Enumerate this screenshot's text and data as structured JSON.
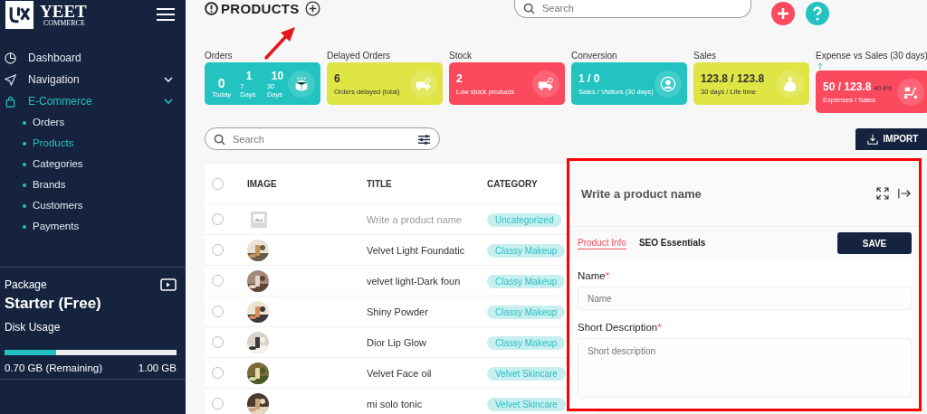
{
  "sidebar": {
    "logo": {
      "word": "YEET",
      "sub": "COMMERCE"
    },
    "items": [
      {
        "label": "Dashboard",
        "active": false,
        "expandable": false
      },
      {
        "label": "Navigation",
        "active": false,
        "expandable": true
      },
      {
        "label": "E-Commerce",
        "active": true,
        "expandable": true,
        "children": [
          {
            "label": "Orders",
            "selected": false
          },
          {
            "label": "Products",
            "selected": true
          },
          {
            "label": "Categories",
            "selected": false
          },
          {
            "label": "Brands",
            "selected": false
          },
          {
            "label": "Customers",
            "selected": false
          },
          {
            "label": "Payments",
            "selected": false
          }
        ]
      }
    ],
    "package": {
      "label": "Package",
      "plan": "Starter (Free)"
    },
    "disk": {
      "label": "Disk Usage",
      "level": 0.3,
      "remaining": "0.70 GB (Remaining)",
      "total": "1.00 GB"
    }
  },
  "header": {
    "title": "PRODUCTS",
    "search": {
      "placeholder": "Search"
    }
  },
  "stats": [
    {
      "label": "Orders",
      "kind": "triple",
      "color": "#22c3c0",
      "values": [
        {
          "value": "0",
          "caption": "Today"
        },
        {
          "value": "1",
          "caption": "7 Days"
        },
        {
          "value": "10",
          "caption": "30 Days"
        }
      ]
    },
    {
      "label": "Delayed Orders",
      "kind": "single",
      "color": "#dfe545",
      "value": "6",
      "caption": "Orders delayed (total)"
    },
    {
      "label": "Stock",
      "kind": "single",
      "color": "#fb4a5e",
      "value": "2",
      "caption": "Low stock products"
    },
    {
      "label": "Conversion",
      "kind": "single",
      "color": "#22c3c0",
      "value": "1 / 0",
      "caption": "Sales / Visitors (30 days)"
    },
    {
      "label": "Sales",
      "kind": "single",
      "color": "#dfe545",
      "value": "123.8 / 123.8",
      "caption": "30 days / Life time"
    },
    {
      "label": "Expense vs Sales (30 days)",
      "kind": "ratio",
      "color": "#fb4a5e",
      "value": "50 / 123.8",
      "percent": "40.4%",
      "caption": "Expenses / Sales"
    }
  ],
  "toolbar": {
    "search": {
      "placeholder": "Search"
    },
    "import": "IMPORT"
  },
  "table": {
    "columns": [
      "IMAGE",
      "TITLE",
      "CATEGORY"
    ],
    "all_checked": false,
    "rows": [
      {
        "kind": "draft",
        "checked": false,
        "title": "Write a product name",
        "category": "Uncategorized"
      },
      {
        "kind": "product",
        "checked": false,
        "title": "Velvet Light Foundatic",
        "category": "Classy Makeup"
      },
      {
        "kind": "product",
        "checked": false,
        "title": "velvet light-Dark foun",
        "category": "Classy Makeup"
      },
      {
        "kind": "product",
        "checked": false,
        "title": "Shiny Powder",
        "category": "Classy Makeup"
      },
      {
        "kind": "product",
        "checked": false,
        "title": "Dior Lip Glow",
        "category": "Classy Makeup"
      },
      {
        "kind": "product",
        "checked": false,
        "title": "Velvet Face oil",
        "category": "Velvet Skincare"
      },
      {
        "kind": "product",
        "checked": false,
        "title": "mi solo tonic",
        "category": "Velvet Skincare"
      }
    ]
  },
  "panel": {
    "title": "Write a product name",
    "tabs": [
      {
        "label": "Product Info",
        "selected": true
      },
      {
        "label": "SEO Essentials",
        "selected": false
      }
    ],
    "save": "SAVE",
    "fields": [
      {
        "kind": "input",
        "label": "Name",
        "required_mark": "*",
        "placeholder": "Name"
      },
      {
        "kind": "textarea",
        "label": "Short Description",
        "required_mark": "*",
        "placeholder": "Short description"
      }
    ]
  }
}
